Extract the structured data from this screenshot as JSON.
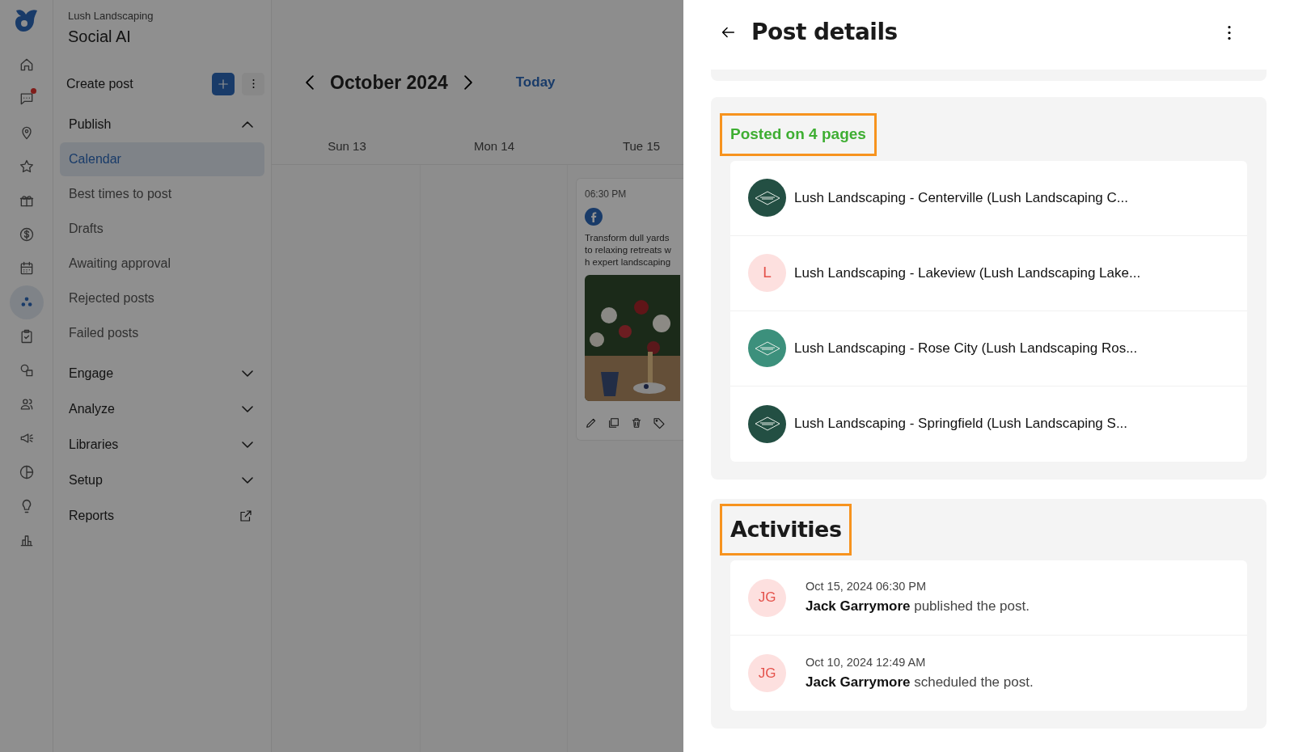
{
  "rail": {
    "items": [
      {
        "selected": false,
        "badge": false
      },
      {
        "selected": false,
        "badge": true
      },
      {
        "selected": false,
        "badge": false
      },
      {
        "selected": false,
        "badge": false
      },
      {
        "selected": false,
        "badge": false
      },
      {
        "selected": false,
        "badge": false
      },
      {
        "selected": false,
        "badge": false
      },
      {
        "selected": true,
        "badge": false
      },
      {
        "selected": false,
        "badge": false
      },
      {
        "selected": false,
        "badge": false
      },
      {
        "selected": false,
        "badge": false
      },
      {
        "selected": false,
        "badge": false
      },
      {
        "selected": false,
        "badge": false
      },
      {
        "selected": false,
        "badge": false
      },
      {
        "selected": false,
        "badge": false
      }
    ]
  },
  "sidebar": {
    "account": "Lush Landscaping",
    "app_title": "Social AI",
    "create_label": "Create post",
    "sections": [
      {
        "label": "Publish",
        "kind": "group",
        "expanded": true,
        "children": [
          {
            "label": "Calendar",
            "selected": true
          },
          {
            "label": "Best times to post",
            "selected": false
          },
          {
            "label": "Drafts",
            "selected": false
          },
          {
            "label": "Awaiting approval",
            "selected": false
          },
          {
            "label": "Rejected posts",
            "selected": false
          },
          {
            "label": "Failed posts",
            "selected": false
          }
        ]
      },
      {
        "label": "Engage",
        "kind": "group",
        "expanded": false
      },
      {
        "label": "Analyze",
        "kind": "group",
        "expanded": false
      },
      {
        "label": "Libraries",
        "kind": "group",
        "expanded": false
      },
      {
        "label": "Setup",
        "kind": "group",
        "expanded": false
      },
      {
        "label": "Reports",
        "kind": "external"
      }
    ]
  },
  "calendar": {
    "month": "October 2024",
    "today_label": "Today",
    "days": [
      {
        "label": "Sun 13"
      },
      {
        "label": "Mon 14"
      },
      {
        "label": "Tue 15",
        "posts": [
          {
            "time": "06:30 PM",
            "text_lines": [
              "Transform dull yards",
              "to relaxing retreats w",
              "h expert landscaping"
            ],
            "media": {
              "kind": "picture"
            }
          }
        ]
      }
    ]
  },
  "panel": {
    "title": "Post details",
    "pages_section": {
      "heading": "Posted on 4 pages",
      "highlighted": true,
      "pages": [
        {
          "name": "Lush Landscaping - Centerville (Lush Landscaping C...",
          "kind": "logo",
          "color": "#234f43"
        },
        {
          "name": "Lush Landscaping - Lakeview (Lush Landscaping Lake...",
          "kind": "initial",
          "initial": "L",
          "color": "#fde0df"
        },
        {
          "name": "Lush Landscaping - Rose City (Lush Landscaping Ros...",
          "kind": "logo",
          "color": "#3c907c"
        },
        {
          "name": "Lush Landscaping - Springfield (Lush Landscaping S...",
          "kind": "logo",
          "color": "#234f43"
        }
      ]
    },
    "activities_section": {
      "heading": "Activities",
      "highlighted": true,
      "items": [
        {
          "initials": "JG",
          "time": "Oct 15, 2024 06:30 PM",
          "user": "Jack Garrymore",
          "action": "published the post."
        },
        {
          "initials": "JG",
          "time": "Oct 10, 2024 12:49 AM",
          "user": "Jack Garrymore",
          "action": "scheduled the post."
        }
      ]
    }
  }
}
